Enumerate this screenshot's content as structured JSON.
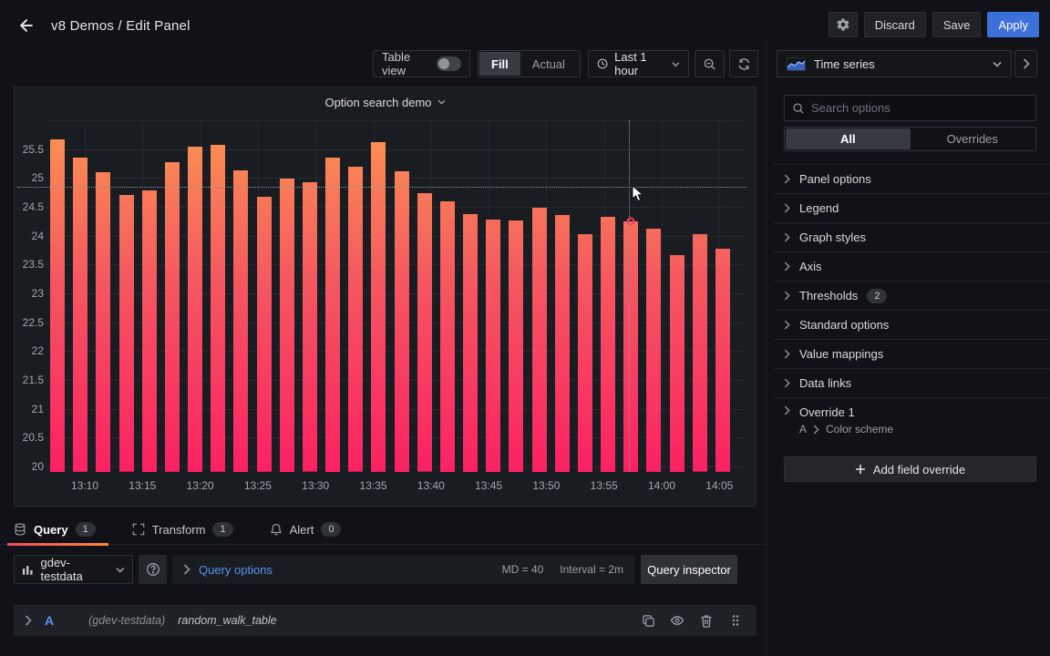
{
  "header": {
    "breadcrumb": "v8 Demos / Edit Panel",
    "discard": "Discard",
    "save": "Save",
    "apply": "Apply"
  },
  "toolbar": {
    "table_view": "Table view",
    "fill": "Fill",
    "actual": "Actual",
    "time_range": "Last 1 hour"
  },
  "viz": {
    "label": "Time series"
  },
  "sidebar": {
    "search_placeholder": "Search options",
    "tab_all": "All",
    "tab_overrides": "Overrides",
    "sections": [
      {
        "label": "Panel options"
      },
      {
        "label": "Legend"
      },
      {
        "label": "Graph styles"
      },
      {
        "label": "Axis"
      },
      {
        "label": "Thresholds",
        "badge": "2"
      },
      {
        "label": "Standard options"
      },
      {
        "label": "Value mappings"
      },
      {
        "label": "Data links"
      },
      {
        "label": "Override 1",
        "sub_ref": "A",
        "sub_path": "Color scheme"
      }
    ],
    "add_override": "Add field override"
  },
  "chart_data": {
    "type": "bar",
    "title": "Option search demo",
    "xlabel": "",
    "ylabel": "",
    "x_ticks": [
      "13:10",
      "13:15",
      "13:20",
      "13:25",
      "13:30",
      "13:35",
      "13:40",
      "13:45",
      "13:50",
      "13:55",
      "14:00",
      "14:05"
    ],
    "y_ticks": [
      25.5,
      25,
      24.5,
      24,
      23.5,
      23,
      22.5,
      22,
      21.5,
      21,
      20.5,
      20
    ],
    "y_grid_extra": [
      26
    ],
    "ylim": [
      19.905,
      26.0
    ],
    "interval_minutes": 2,
    "values": [
      25.67,
      25.35,
      25.1,
      24.7,
      24.79,
      25.27,
      25.55,
      25.57,
      25.14,
      24.67,
      24.99,
      24.92,
      25.36,
      25.19,
      25.62,
      25.12,
      24.73,
      24.6,
      24.38,
      24.28,
      24.27,
      24.49,
      24.36,
      24.03,
      24.33,
      24.25,
      24.12,
      23.67,
      24.02,
      23.77
    ],
    "hovered_bar_index": 25,
    "crosshair": {
      "x": 674,
      "y": 109
    },
    "legend": "off",
    "grid": "on",
    "colors": {
      "bar_gradient": [
        "#fb9552",
        "#f55860",
        "#fb2163"
      ],
      "hover_ring": "#ff3d64"
    }
  },
  "tabs": [
    {
      "label": "Query",
      "badge": "1",
      "icon": "database-icon",
      "active": true
    },
    {
      "label": "Transform",
      "badge": "1",
      "icon": "transform-icon",
      "active": false
    },
    {
      "label": "Alert",
      "badge": "0",
      "icon": "bell-icon",
      "active": false
    }
  ],
  "query": {
    "datasource": "gdev-testdata",
    "options_label": "Query options",
    "md": "MD = 40",
    "interval": "Interval = 2m",
    "inspector": "Query inspector",
    "row": {
      "ref": "A",
      "ds": "(gdev-testdata)",
      "scenario": "random_walk_table"
    }
  },
  "colors": {
    "accent_blue": "#3d71d9",
    "link_blue": "#5794f2",
    "tab_underline": [
      "#f2495c",
      "#ff8833"
    ]
  }
}
